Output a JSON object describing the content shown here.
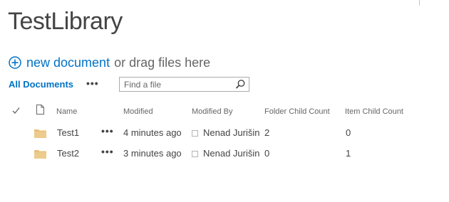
{
  "library": {
    "title": "TestLibrary"
  },
  "upload": {
    "new_document_label": "new document",
    "drag_label": "or drag files here"
  },
  "views": {
    "current": "All Documents",
    "more": "•••"
  },
  "search": {
    "placeholder": "Find a file"
  },
  "columns": {
    "check": "✓",
    "name": "Name",
    "modified": "Modified",
    "modified_by": "Modified By",
    "folder_child_count": "Folder Child Count",
    "item_child_count": "Item Child Count"
  },
  "rows": [
    {
      "name": "Test1",
      "more": "•••",
      "modified": "4 minutes ago",
      "modified_by": "Nenad Jurišin",
      "folder_child_count": "2",
      "item_child_count": "0"
    },
    {
      "name": "Test2",
      "more": "•••",
      "modified": "3 minutes ago",
      "modified_by": "Nenad Jurišin",
      "folder_child_count": "0",
      "item_child_count": "1"
    }
  ],
  "colors": {
    "accent": "#0072c6",
    "folder": "#e8c07a",
    "text": "#444444"
  }
}
